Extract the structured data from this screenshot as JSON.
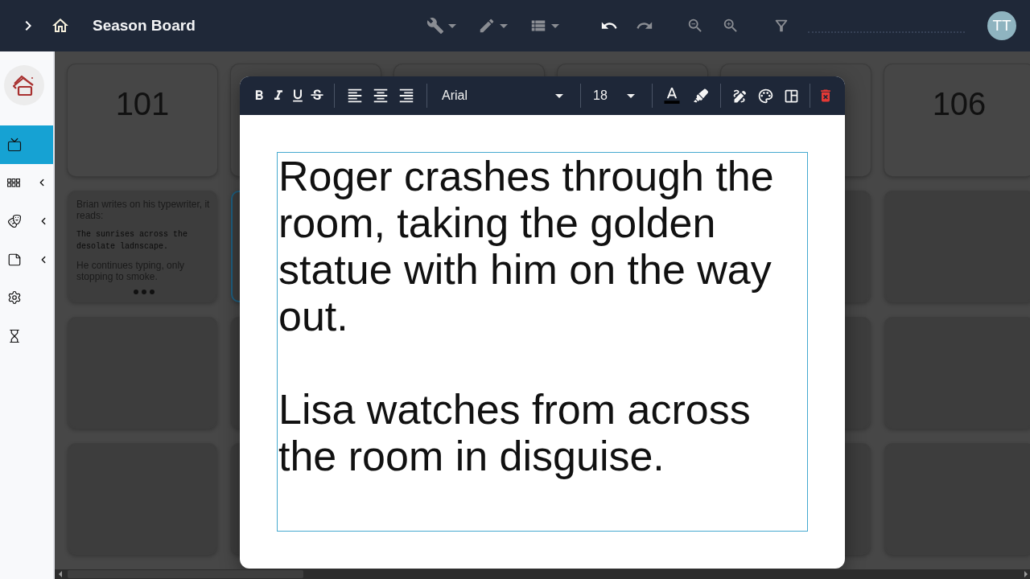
{
  "top_bar": {
    "title": "Season Board",
    "tool_groups": [
      [
        {
          "kind": "menu",
          "disabled": true
        },
        {
          "kind": "menu",
          "disabled": true
        },
        {
          "kind": "menu",
          "disabled": true
        }
      ],
      [
        {
          "kind": "button",
          "disabled": false
        },
        {
          "kind": "button",
          "disabled": true
        }
      ],
      [
        {
          "kind": "button",
          "disabled": true
        },
        {
          "kind": "button",
          "disabled": true
        }
      ],
      [
        {
          "kind": "button",
          "disabled": true
        }
      ]
    ],
    "avatar": "TT"
  },
  "sidebar": {
    "items": [
      {
        "kind": "link",
        "selected": true
      },
      {
        "kind": "group",
        "selected": false
      },
      {
        "kind": "group",
        "selected": false
      },
      {
        "kind": "group",
        "selected": false
      },
      {
        "kind": "link",
        "selected": false
      },
      {
        "kind": "link",
        "selected": false
      }
    ]
  },
  "board": {
    "columns": [
      {
        "number": "101",
        "cards": [
          {
            "selected": false,
            "paragraphs": [
              {
                "kind": "action",
                "text": "Brian writes on his typewriter, it reads:"
              },
              {
                "kind": "typed",
                "text": "The sunrises across the desolate ladnscape."
              },
              {
                "kind": "action",
                "text": "He continues typing, only stopping to smoke."
              }
            ]
          },
          {
            "selected": false
          },
          {
            "selected": false
          }
        ]
      },
      {
        "cards": [
          {
            "selected": true
          },
          {
            "selected": false
          },
          {
            "selected": false
          }
        ]
      },
      {},
      {},
      {
        "cards": [
          {
            "selected": false
          },
          {
            "selected": false
          },
          {
            "selected": false
          }
        ]
      },
      {
        "number": "106",
        "cards": [
          {
            "selected": false
          },
          {
            "selected": false
          },
          {
            "selected": false
          }
        ]
      }
    ]
  },
  "editor": {
    "toolbar": {
      "font": "Arial",
      "size": "18"
    },
    "paragraphs": [
      "Roger crashes through the room, taking the golden statue with him on the way out.",
      "Lisa watches from across the room in disguise."
    ]
  }
}
